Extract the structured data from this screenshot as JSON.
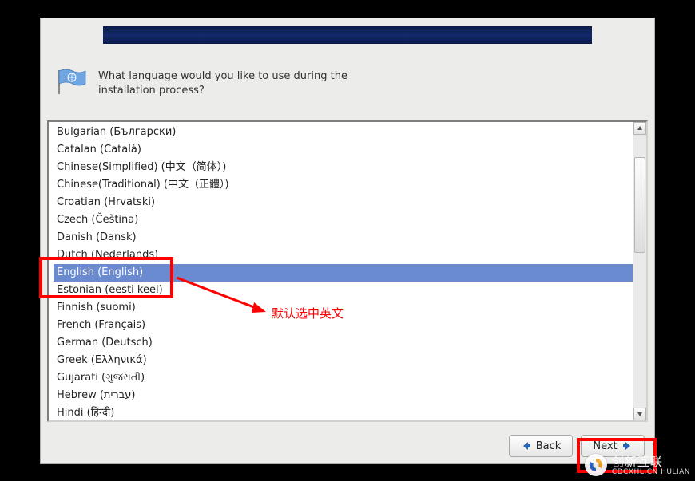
{
  "prompt": "What language would you like to use during the installation process?",
  "languages": [
    "Bulgarian (Български)",
    "Catalan (Català)",
    "Chinese(Simplified) (中文（简体）)",
    "Chinese(Traditional) (中文（正體）)",
    "Croatian (Hrvatski)",
    "Czech (Čeština)",
    "Danish (Dansk)",
    "Dutch (Nederlands)",
    "English (English)",
    "Estonian (eesti keel)",
    "Finnish (suomi)",
    "French (Français)",
    "German (Deutsch)",
    "Greek (Ελληνικά)",
    "Gujarati (ગુજરાતી)",
    "Hebrew (עברית)",
    "Hindi (हिन्दी)"
  ],
  "selected_index": 8,
  "buttons": {
    "back": "Back",
    "next": "Next"
  },
  "annotation": {
    "label": "默认选中英文"
  },
  "watermark": {
    "brand": "创新互联",
    "sub": "CDCXHL.CN HULIAN"
  }
}
